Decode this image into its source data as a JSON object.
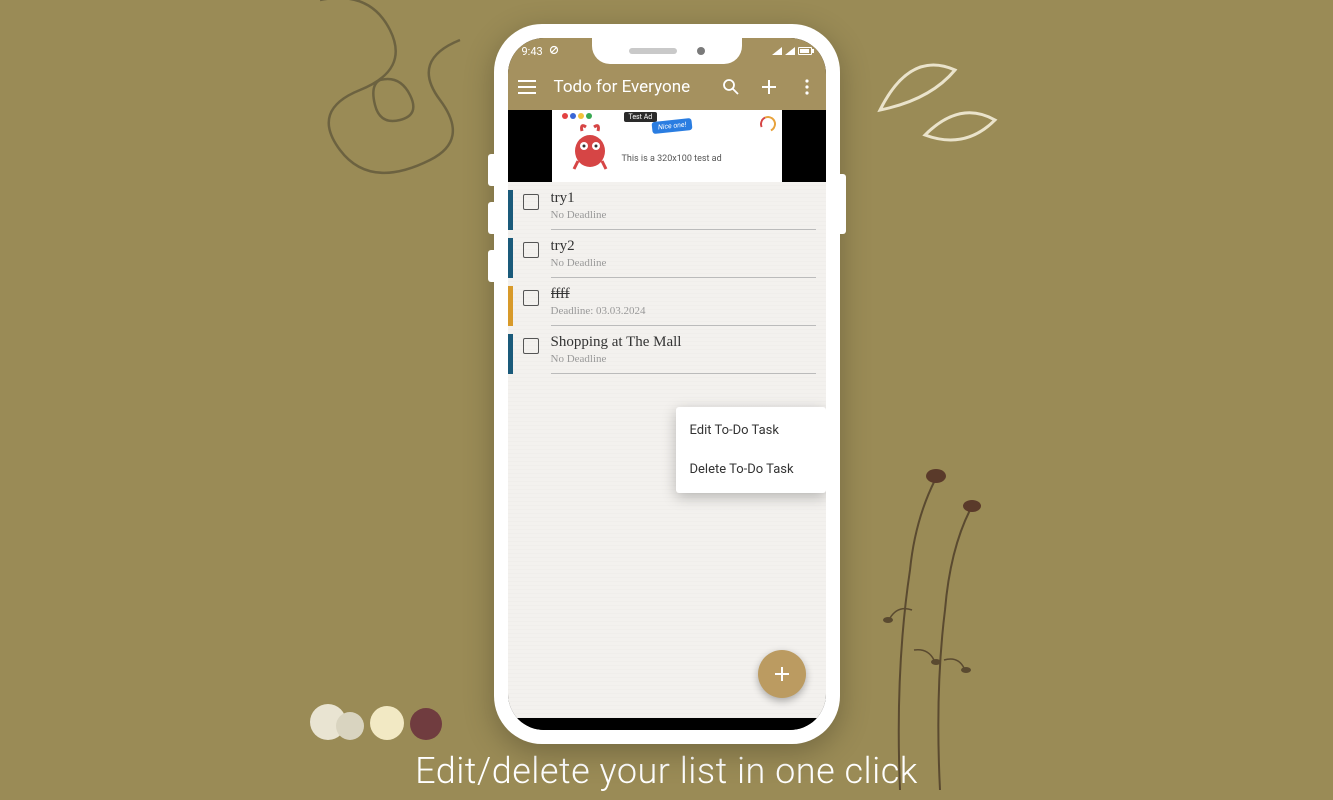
{
  "caption": "Edit/delete your list in one click",
  "statusbar": {
    "time": "9:43"
  },
  "appbar": {
    "title": "Todo for Everyone"
  },
  "ad": {
    "badge": "Test Ad",
    "bubble": "Nice one!",
    "text": "This is a 320x100 test ad"
  },
  "todos": [
    {
      "title": "try1",
      "subtitle": "No Deadline",
      "stripe": "blue",
      "strike": false
    },
    {
      "title": "try2",
      "subtitle": "No Deadline",
      "stripe": "blue",
      "strike": false
    },
    {
      "title": "ffff",
      "subtitle": "Deadline: 03.03.2024",
      "stripe": "orange",
      "strike": true
    },
    {
      "title": "Shopping at The Mall",
      "subtitle": "No Deadline",
      "stripe": "blue",
      "strike": false
    }
  ],
  "context_menu": {
    "edit": "Edit To-Do Task",
    "delete": "Delete To-Do Task"
  }
}
